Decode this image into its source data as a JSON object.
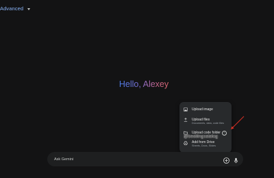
{
  "header": {
    "model_label": "Advanced",
    "chevron_icon": "chevron-down-icon"
  },
  "main": {
    "greeting": "Hello, Alexey"
  },
  "upload_menu": {
    "items": [
      {
        "label": "Upload image",
        "sublabel": "",
        "icon": "image-icon"
      },
      {
        "label": "Upload files",
        "sublabel": "Documents, data, code files",
        "icon": "upload-icon"
      },
      {
        "label": "Upload code folder",
        "sublabel": "",
        "icon": "folder-icon",
        "info_badge": "!"
      },
      {
        "label": "Add from Drive",
        "sublabel": "Sheets, Docs, Slides",
        "icon": "drive-icon"
      }
    ]
  },
  "overlay": {
    "watermark": "@bestiingcatalog",
    "arrow_color": "#d93025"
  },
  "composer": {
    "placeholder": "Ask Gemini",
    "add_icon": "add-circle-icon",
    "mic_icon": "microphone-icon"
  },
  "colors": {
    "background": "#131314",
    "accent": "#8ab4f8",
    "menu_bg": "#282a2c",
    "input_bg": "#1e1f20"
  }
}
